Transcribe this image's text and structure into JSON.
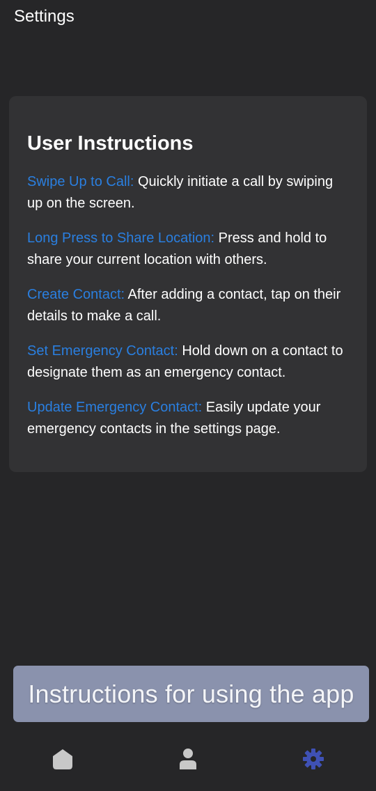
{
  "header": {
    "title": "Settings"
  },
  "card": {
    "title": "User Instructions",
    "items": [
      {
        "key": "Swipe Up to Call:",
        "text": " Quickly initiate a call by swiping up on the screen."
      },
      {
        "key": "Long Press to Share Location:",
        "text": " Press and hold to share your current location with others."
      },
      {
        "key": "Create Contact:",
        "text": " After adding a contact, tap on their details to make a call."
      },
      {
        "key": "Set Emergency Contact:",
        "text": " Hold down on a contact to designate them as an emergency contact."
      },
      {
        "key": "Update Emergency Contact:",
        "text": " Easily update your emergency contacts in the settings page."
      }
    ]
  },
  "caption": {
    "text": "Instructions for using the app"
  },
  "nav": {
    "items": [
      {
        "icon": "home-icon",
        "active": false
      },
      {
        "icon": "person-icon",
        "active": false
      },
      {
        "icon": "gear-icon",
        "active": true
      }
    ]
  },
  "colors": {
    "background": "#262628",
    "card": "#323234",
    "accent_link": "#2a7fe0",
    "caption_bg": "#8a92ad",
    "nav_inactive": "#c8c8c8",
    "nav_active": "#3f51b5"
  }
}
